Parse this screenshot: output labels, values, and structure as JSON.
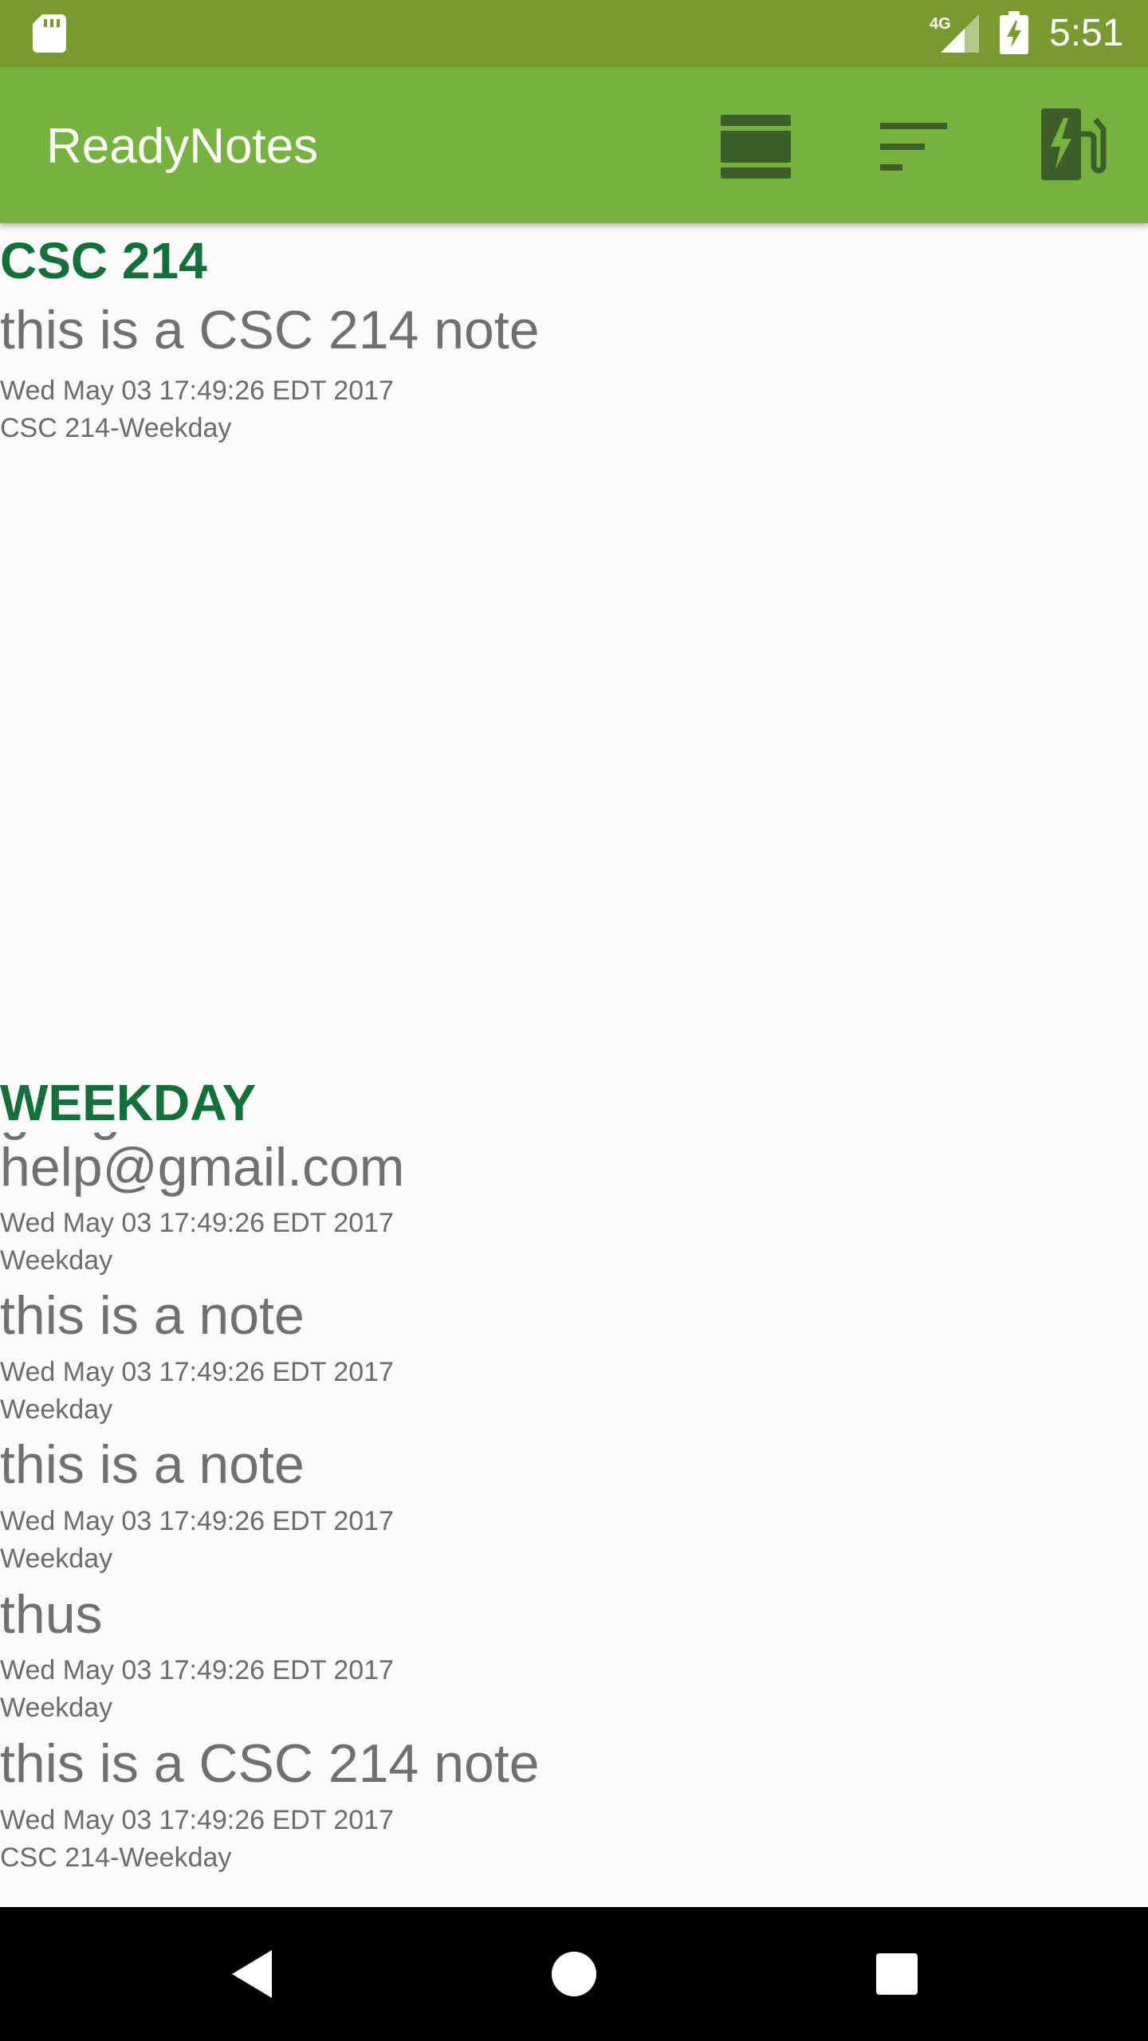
{
  "status_bar": {
    "time": "5:51",
    "network": "4G",
    "icons": [
      "sd-card-icon",
      "signal-4g-icon",
      "battery-charging-icon"
    ]
  },
  "app_bar": {
    "title": "ReadyNotes",
    "actions": [
      "view-agenda-icon",
      "sort-icon",
      "ev-station-icon"
    ]
  },
  "sections": [
    {
      "header": "CSC 214",
      "notes": [
        {
          "body": "this is a CSC 214 note",
          "date": "Wed May 03 17:49:26 EDT 2017",
          "category": "CSC 214-Weekday"
        }
      ]
    },
    {
      "header": "WEEKDAY",
      "notes": [
        {
          "body_lines": [
            "google.com",
            "help@gmail.com"
          ],
          "date": "Wed May 03 17:49:26 EDT 2017",
          "category": "Weekday"
        },
        {
          "body": "this is a note",
          "date": "Wed May 03 17:49:26 EDT 2017",
          "category": "Weekday"
        },
        {
          "body": "this is a note",
          "date": "Wed May 03 17:49:26 EDT 2017",
          "category": "Weekday"
        },
        {
          "body": "thus",
          "date": "Wed May 03 17:49:26 EDT 2017",
          "category": "Weekday"
        },
        {
          "body": "this is a CSC 214 note",
          "date": "Wed May 03 17:49:26 EDT 2017",
          "category": "CSC 214-Weekday"
        }
      ]
    }
  ],
  "nav_bar": {
    "buttons": [
      "back-icon",
      "home-icon",
      "recents-icon"
    ]
  },
  "colors": {
    "status_bar": "#7a9a30",
    "app_bar": "#76b33e",
    "section_header": "#12703a",
    "note_text": "#707070",
    "background": "#fafafa"
  }
}
